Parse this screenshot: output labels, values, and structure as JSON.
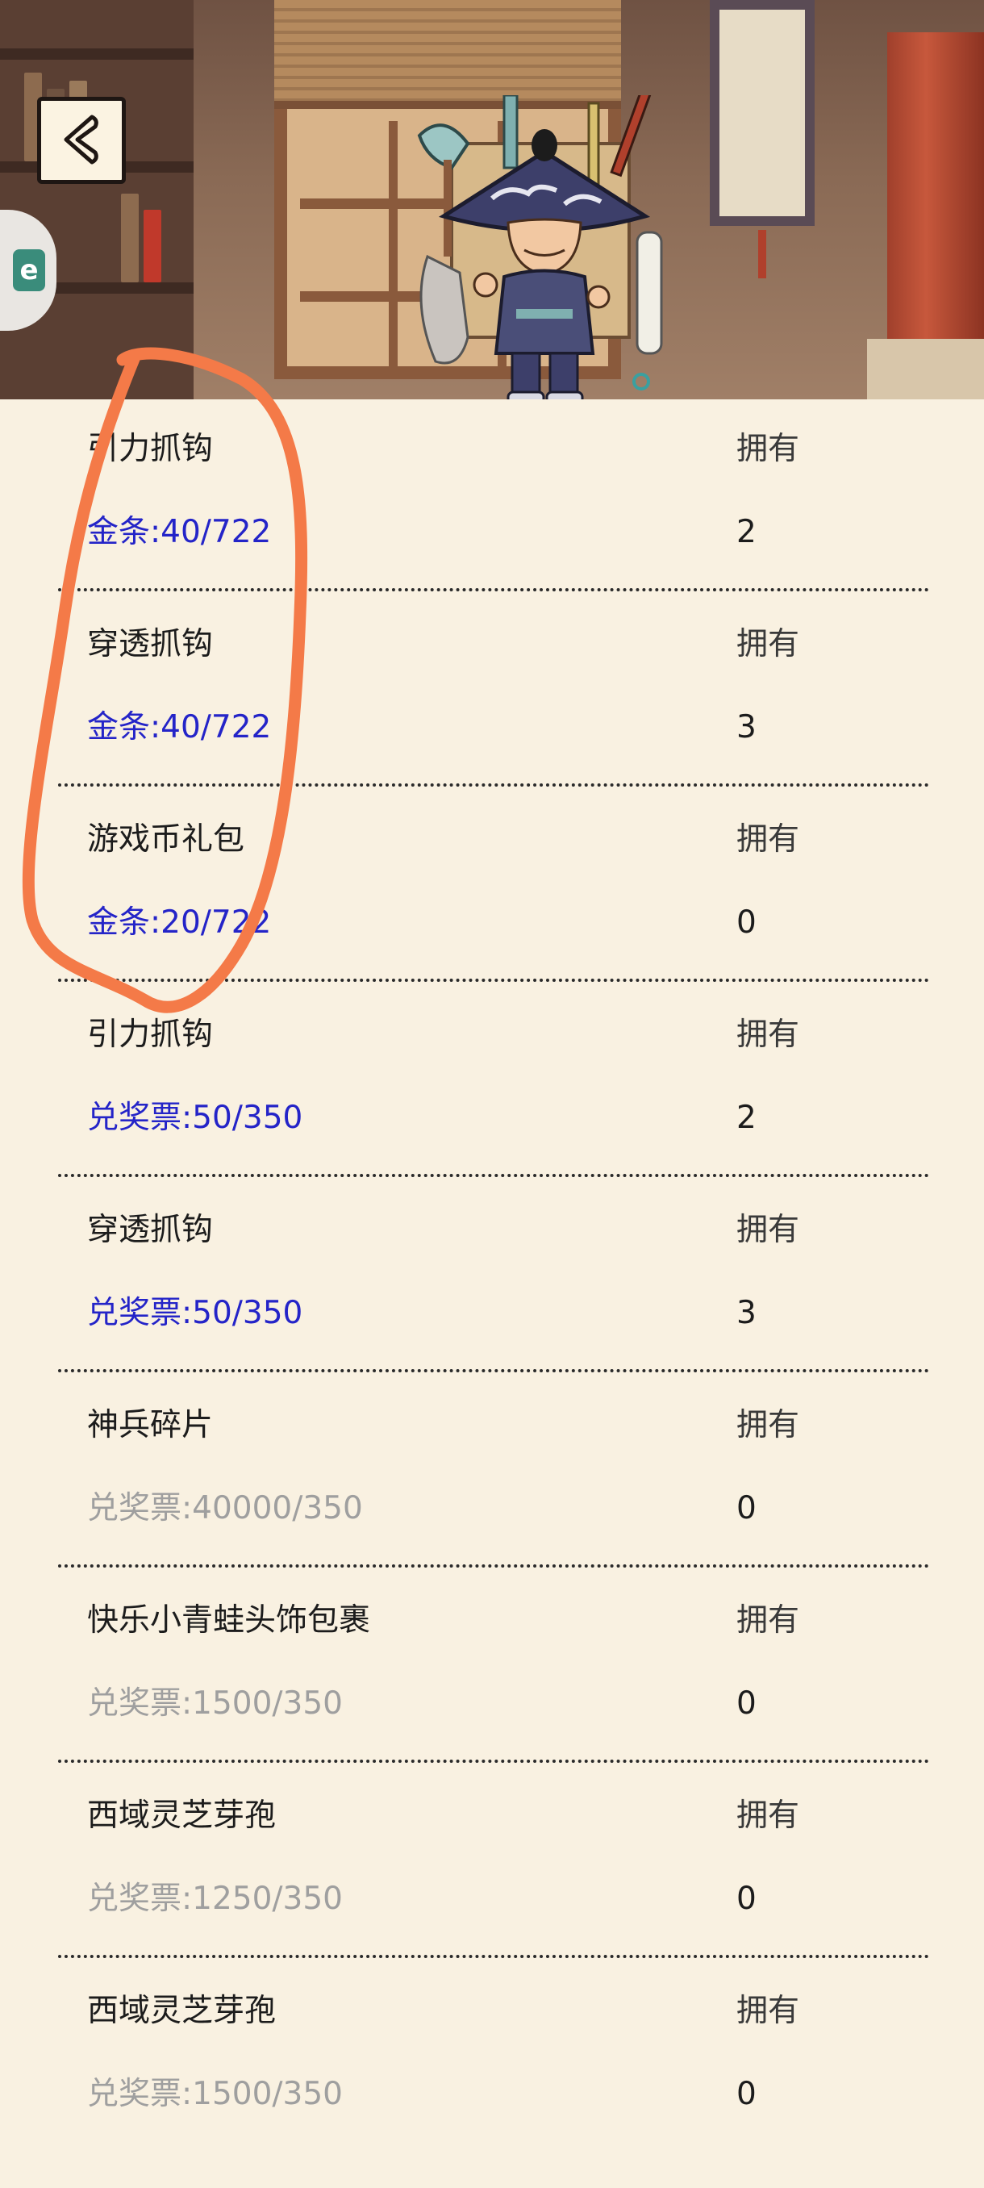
{
  "header": {
    "back_icon": "chevron-left-icon",
    "side_badge": "e"
  },
  "items": [
    {
      "name": "引力抓钩",
      "owned_label": "拥有",
      "price": "金条:40/722",
      "owned": "2",
      "affordable": true
    },
    {
      "name": "穿透抓钩",
      "owned_label": "拥有",
      "price": "金条:40/722",
      "owned": "3",
      "affordable": true
    },
    {
      "name": "游戏币礼包",
      "owned_label": "拥有",
      "price": "金条:20/722",
      "owned": "0",
      "affordable": true
    },
    {
      "name": "引力抓钩",
      "owned_label": "拥有",
      "price": "兑奖票:50/350",
      "owned": "2",
      "affordable": true
    },
    {
      "name": "穿透抓钩",
      "owned_label": "拥有",
      "price": "兑奖票:50/350",
      "owned": "3",
      "affordable": true
    },
    {
      "name": "神兵碎片",
      "owned_label": "拥有",
      "price": "兑奖票:40000/350",
      "owned": "0",
      "affordable": false
    },
    {
      "name": "快乐小青蛙头饰包裹",
      "owned_label": "拥有",
      "price": "兑奖票:1500/350",
      "owned": "0",
      "affordable": false
    },
    {
      "name": "西域灵芝芽孢",
      "owned_label": "拥有",
      "price": "兑奖票:1250/350",
      "owned": "0",
      "affordable": false
    },
    {
      "name": "西域灵芝芽孢",
      "owned_label": "拥有",
      "price": "兑奖票:1500/350",
      "owned": "0",
      "affordable": false
    }
  ],
  "colors": {
    "background": "#f9f1e1",
    "price_active": "#2424c8",
    "price_inactive": "#9f9f9f",
    "annotation_stroke": "#f47a48"
  }
}
